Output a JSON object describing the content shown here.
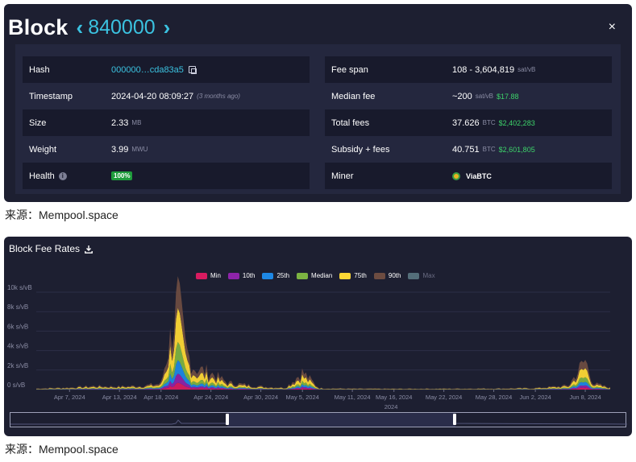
{
  "block": {
    "title": "Block",
    "height": "840000",
    "prev_arrow": "‹",
    "next_arrow": "›",
    "close": "×",
    "left_rows": [
      {
        "label": "Hash",
        "value": "000000…cda83a5"
      },
      {
        "label": "Timestamp",
        "value": "2024-04-20 08:09:27",
        "note": "(3 months ago)"
      },
      {
        "label": "Size",
        "value": "2.33",
        "unit": "MB"
      },
      {
        "label": "Weight",
        "value": "3.99",
        "unit": "MWU"
      },
      {
        "label": "Health",
        "value": "100%"
      }
    ],
    "right_rows": [
      {
        "label": "Fee span",
        "value": "108 - 3,604,819",
        "unit": "sat/vB"
      },
      {
        "label": "Median fee",
        "value": "~200",
        "unit": "sat/vB",
        "fiat": "$17.88"
      },
      {
        "label": "Total fees",
        "value": "37.626",
        "unit": "BTC",
        "fiat": "$2,402,283"
      },
      {
        "label": "Subsidy + fees",
        "value": "40.751",
        "unit": "BTC",
        "fiat": "$2,601,805"
      },
      {
        "label": "Miner",
        "value": "ViaBTC"
      }
    ]
  },
  "captions": {
    "first": "来源：Mempool.space",
    "second": "来源：Mempool.space"
  },
  "chart_panel": {
    "title": "Block Fee Rates",
    "icons": {
      "download": "download-icon"
    },
    "x_year": "2024"
  },
  "chart_data": {
    "type": "area",
    "title": "Block Fee Rates",
    "ylabel": "",
    "xlabel": "2024",
    "y_ticks": [
      "0 s/vB",
      "2k s/vB",
      "4k s/vB",
      "6k s/vB",
      "8k s/vB",
      "10k s/vB"
    ],
    "ylim": [
      0,
      10000
    ],
    "x_ticks": [
      "Apr 7, 2024",
      "Apr 13, 2024",
      "Apr 18, 2024",
      "Apr 24, 2024",
      "Apr 30, 2024",
      "May 5, 2024",
      "May 11, 2024",
      "May 16, 2024",
      "May 22, 2024",
      "May 28, 2024",
      "Jun 2, 2024",
      "Jun 8, 2024"
    ],
    "stacked": true,
    "legend_position": "top",
    "grid": true,
    "series": [
      {
        "name": "Min",
        "color": "#d81b60",
        "enabled": true
      },
      {
        "name": "10th",
        "color": "#8e24aa",
        "enabled": true
      },
      {
        "name": "25th",
        "color": "#1e88e5",
        "enabled": true
      },
      {
        "name": "Median",
        "color": "#7cb342",
        "enabled": true
      },
      {
        "name": "75th",
        "color": "#fdd835",
        "enabled": true
      },
      {
        "name": "90th",
        "color": "#6d4c41",
        "enabled": true
      },
      {
        "name": "Max",
        "color": "#546e7a",
        "enabled": false
      }
    ],
    "daily_total_s_per_vb": [
      {
        "date": "Apr 3, 2024",
        "value": 120
      },
      {
        "date": "Apr 7, 2024",
        "value": 200
      },
      {
        "date": "Apr 10, 2024",
        "value": 350
      },
      {
        "date": "Apr 13, 2024",
        "value": 300
      },
      {
        "date": "Apr 16, 2024",
        "value": 400
      },
      {
        "date": "Apr 18, 2024",
        "value": 600
      },
      {
        "date": "Apr 20, 2024",
        "value": 8900
      },
      {
        "date": "Apr 21, 2024",
        "value": 4000
      },
      {
        "date": "Apr 22, 2024",
        "value": 2200
      },
      {
        "date": "Apr 24, 2024",
        "value": 1700
      },
      {
        "date": "Apr 26, 2024",
        "value": 700
      },
      {
        "date": "Apr 30, 2024",
        "value": 300
      },
      {
        "date": "May 3, 2024",
        "value": 200
      },
      {
        "date": "May 5, 2024",
        "value": 1800
      },
      {
        "date": "May 7, 2024",
        "value": 150
      },
      {
        "date": "May 11, 2024",
        "value": 100
      },
      {
        "date": "May 16, 2024",
        "value": 90
      },
      {
        "date": "May 22, 2024",
        "value": 100
      },
      {
        "date": "May 28, 2024",
        "value": 120
      },
      {
        "date": "Jun 2, 2024",
        "value": 150
      },
      {
        "date": "Jun 6, 2024",
        "value": 400
      },
      {
        "date": "Jun 8, 2024",
        "value": 3000
      },
      {
        "date": "Jun 9, 2024",
        "value": 600
      },
      {
        "date": "Jun 11, 2024",
        "value": 200
      }
    ]
  }
}
